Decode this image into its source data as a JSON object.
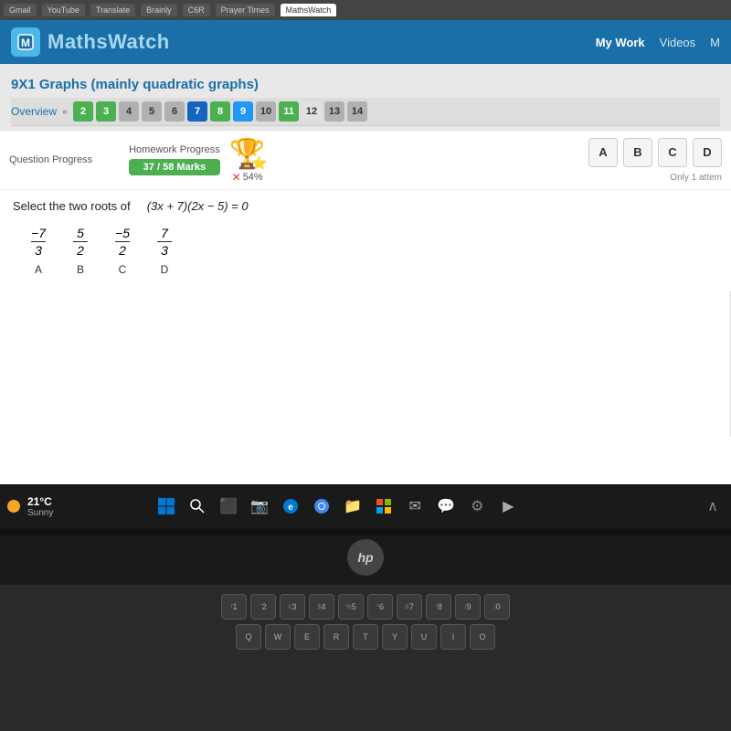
{
  "browser": {
    "tabs": [
      "Gmail",
      "YouTube",
      "Translate",
      "Brainly",
      "C6R",
      "Prayer Times",
      "MathsWatch"
    ]
  },
  "header": {
    "logo_text_maths": "Maths",
    "logo_text_watch": "Watch",
    "nav": {
      "my_work": "My Work",
      "videos": "Videos",
      "more": "M"
    }
  },
  "page": {
    "title": "9X1 Graphs (mainly quadratic graphs)"
  },
  "nav_tabs": {
    "overview": "Overview",
    "tabs": [
      "2",
      "3",
      "4",
      "5",
      "6",
      "7",
      "8",
      "9",
      "10",
      "11",
      "12",
      "13",
      "14"
    ]
  },
  "progress": {
    "question_label": "Question Progress",
    "homework_label": "Homework Progress",
    "marks": "37 / 58 Marks",
    "percent": "54%"
  },
  "question": {
    "instruction": "Select the two roots of",
    "equation": "(3x + 7)(2x − 5) = 0",
    "choices": [
      {
        "label": "A",
        "numerator": "−7",
        "denominator": "3"
      },
      {
        "label": "B",
        "numerator": "5",
        "denominator": "2"
      },
      {
        "label": "C",
        "numerator": "−5",
        "denominator": "2"
      },
      {
        "label": "D",
        "numerator": "7",
        "denominator": "3"
      }
    ]
  },
  "answer_buttons": {
    "labels": [
      "A",
      "B",
      "C",
      "D"
    ]
  },
  "attempt_note": "Only 1 attem",
  "taskbar": {
    "weather_temp": "21°C",
    "weather_desc": "Sunny"
  },
  "keyboard": {
    "row1": [
      "1",
      "2",
      "3",
      "4",
      "5",
      "6",
      "7",
      "8",
      "9",
      "0"
    ],
    "row2": [
      "Q",
      "W",
      "E",
      "R",
      "T",
      "Y",
      "U",
      "I",
      "O"
    ],
    "hp_logo": "hp"
  }
}
